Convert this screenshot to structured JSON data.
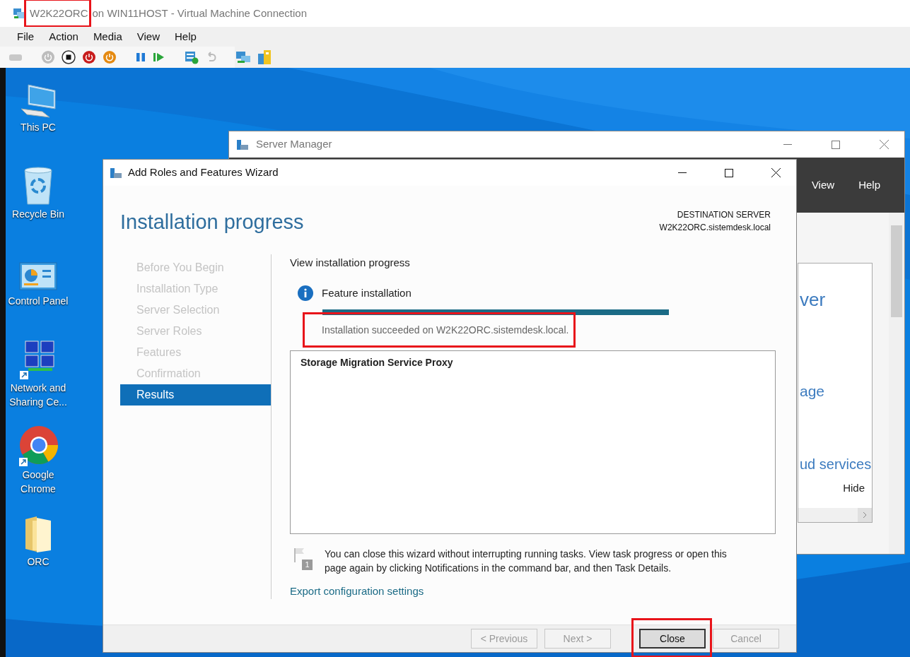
{
  "vm_window": {
    "title_host": "W2K22ORC",
    "title_rest": "on WIN11HOST - Virtual Machine Connection",
    "title_highlighted": true,
    "menu": [
      "File",
      "Action",
      "Media",
      "View",
      "Help"
    ],
    "toolbar": [
      {
        "kind": "ctrl-alt-del",
        "disabled": true
      },
      {
        "kind": "separator"
      },
      {
        "kind": "start",
        "disabled": true
      },
      {
        "kind": "turn-off",
        "disabled": false
      },
      {
        "kind": "shutdown",
        "disabled": false
      },
      {
        "kind": "save",
        "disabled": false
      },
      {
        "kind": "separator"
      },
      {
        "kind": "pause",
        "disabled": false
      },
      {
        "kind": "resume",
        "disabled": false
      },
      {
        "kind": "separator"
      },
      {
        "kind": "checkpoint",
        "disabled": false
      },
      {
        "kind": "revert",
        "disabled": true
      },
      {
        "kind": "separator"
      },
      {
        "kind": "enhanced",
        "disabled": false
      },
      {
        "kind": "share",
        "disabled": false
      }
    ]
  },
  "desktop_icons": [
    {
      "kind": "pc",
      "label": "This PC"
    },
    {
      "kind": "bin",
      "label": "Recycle Bin"
    },
    {
      "kind": "control",
      "label": "Control Panel"
    },
    {
      "kind": "network",
      "label": "Network and Sharing Ce..."
    },
    {
      "kind": "chrome",
      "label": "Google Chrome"
    },
    {
      "kind": "folder",
      "label": "ORC"
    }
  ],
  "server_manager": {
    "title": "Server Manager",
    "menu": [
      "View",
      "Help"
    ],
    "tile_texts": [
      "ver",
      "age",
      "ud services"
    ],
    "hide_link": "Hide"
  },
  "wizard": {
    "title": "Add Roles and Features Wizard",
    "heading": "Installation progress",
    "destination_label": "DESTINATION SERVER",
    "destination_server": "W2K22ORC.sistemdesk.local",
    "steps": [
      {
        "label": "Before You Begin",
        "selected": false
      },
      {
        "label": "Installation Type",
        "selected": false
      },
      {
        "label": "Server Selection",
        "selected": false
      },
      {
        "label": "Server Roles",
        "selected": false
      },
      {
        "label": "Features",
        "selected": false
      },
      {
        "label": "Confirmation",
        "selected": false
      },
      {
        "label": "Results",
        "selected": true
      }
    ],
    "section_title": "View installation progress",
    "feature_label": "Feature installation",
    "progress": {
      "level": 1
    },
    "status": "Installation succeeded on W2K22ORC.sistemdesk.local.",
    "status_highlighted": true,
    "results": [
      "Storage Migration Service Proxy"
    ],
    "note": "You can close this wizard without interrupting running tasks. View task progress or open this page again by clicking Notifications in the command bar, and then Task Details.",
    "note_badge": "1",
    "export_link": "Export configuration settings",
    "buttons": [
      {
        "label": "< Previous",
        "disabled": true,
        "default": false,
        "highlighted": false
      },
      {
        "label": "Next >",
        "disabled": true,
        "default": false,
        "highlighted": false
      },
      {
        "label": "Close",
        "disabled": false,
        "default": true,
        "highlighted": true
      },
      {
        "label": "Cancel",
        "disabled": true,
        "default": false,
        "highlighted": false
      }
    ]
  }
}
